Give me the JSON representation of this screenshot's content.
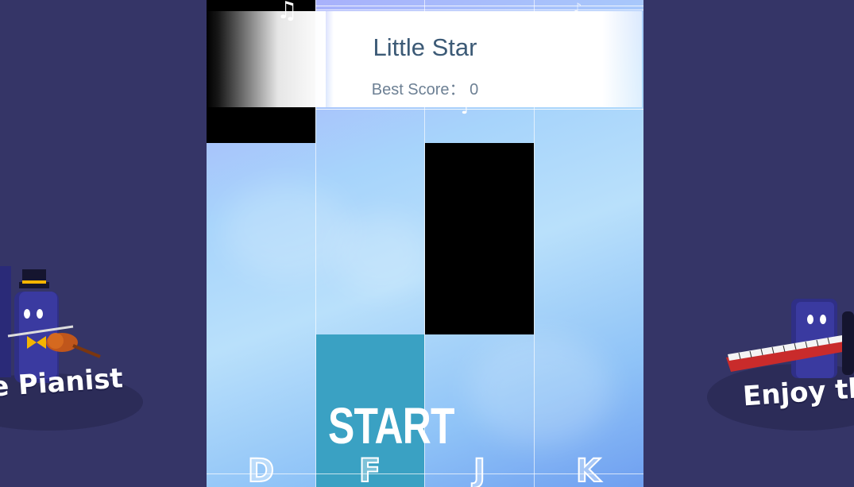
{
  "song": {
    "title": "Little Star",
    "best_score_label": "Best Score",
    "best_score_separator": "：",
    "best_score_value": "0"
  },
  "start_label": "START",
  "keys": [
    "D",
    "F",
    "J",
    "K"
  ],
  "banners": {
    "left": "e Pianist",
    "right": "Enjoy th"
  },
  "colors": {
    "background": "#353567",
    "tile": "#000000",
    "start_tile": "#3aa1c3",
    "title_text": "#3c5a76"
  }
}
